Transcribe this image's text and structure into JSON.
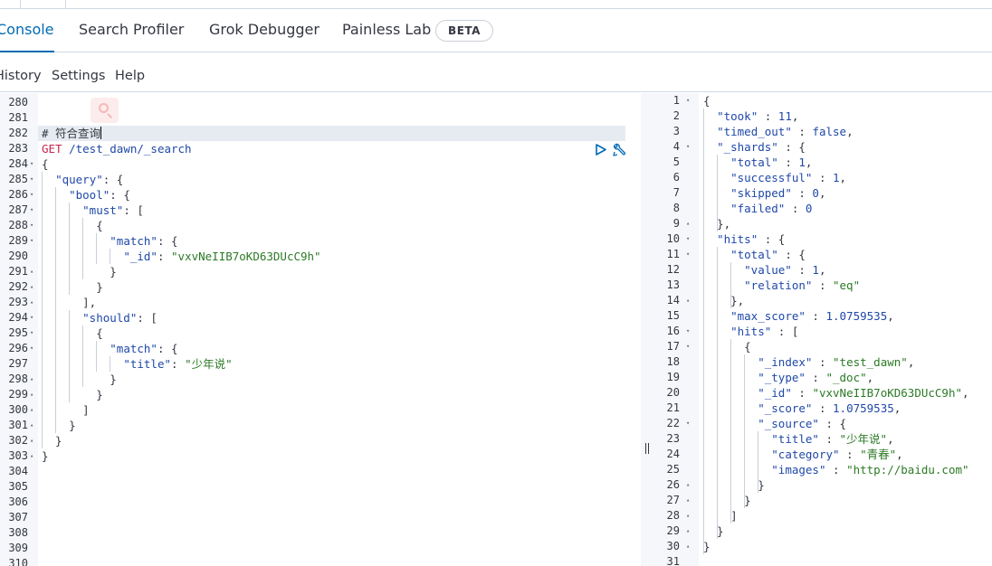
{
  "tabs": [
    {
      "label": "Console"
    },
    {
      "label": "Search Profiler"
    },
    {
      "label": "Grok Debugger"
    },
    {
      "label": "Painless Lab"
    }
  ],
  "beta_badge": "BETA",
  "subnav": {
    "history": "History",
    "settings": "Settings",
    "help": "Help"
  },
  "icons": {
    "run": "play-icon",
    "wrench": "wrench-icon",
    "search": "search-icon"
  },
  "colors": {
    "accent": "#006bb4",
    "string": "#2c7a25",
    "key": "#1f48a8",
    "method": "#c7254e"
  },
  "editor_lines": [
    {
      "n": "280",
      "fold": "",
      "code": ""
    },
    {
      "n": "281",
      "fold": "",
      "code": ""
    },
    {
      "n": "282",
      "fold": "",
      "code": "# 符合查询"
    },
    {
      "n": "283",
      "fold": "",
      "code": "GET /test_dawn/_search"
    },
    {
      "n": "284",
      "fold": "▾",
      "code": "{"
    },
    {
      "n": "285",
      "fold": "▾",
      "code": "  \"query\": {"
    },
    {
      "n": "286",
      "fold": "▾",
      "code": "    \"bool\": {"
    },
    {
      "n": "287",
      "fold": "▾",
      "code": "      \"must\": ["
    },
    {
      "n": "288",
      "fold": "▾",
      "code": "        {"
    },
    {
      "n": "289",
      "fold": "▾",
      "code": "          \"match\": {"
    },
    {
      "n": "290",
      "fold": "",
      "code": "            \"_id\": \"vxvNeIIB7oKD63DUcC9h\""
    },
    {
      "n": "291",
      "fold": "▴",
      "code": "          }"
    },
    {
      "n": "292",
      "fold": "▴",
      "code": "        }"
    },
    {
      "n": "293",
      "fold": "▴",
      "code": "      ],"
    },
    {
      "n": "294",
      "fold": "▾",
      "code": "      \"should\": ["
    },
    {
      "n": "295",
      "fold": "▾",
      "code": "        {"
    },
    {
      "n": "296",
      "fold": "▾",
      "code": "          \"match\": {"
    },
    {
      "n": "297",
      "fold": "",
      "code": "            \"title\": \"少年说\""
    },
    {
      "n": "298",
      "fold": "▴",
      "code": "          }"
    },
    {
      "n": "299",
      "fold": "▴",
      "code": "        }"
    },
    {
      "n": "300",
      "fold": "▴",
      "code": "      ]"
    },
    {
      "n": "301",
      "fold": "▴",
      "code": "    }"
    },
    {
      "n": "302",
      "fold": "▴",
      "code": "  }"
    },
    {
      "n": "303",
      "fold": "▴",
      "code": "}"
    },
    {
      "n": "304",
      "fold": "",
      "code": ""
    },
    {
      "n": "305",
      "fold": "",
      "code": ""
    },
    {
      "n": "306",
      "fold": "",
      "code": ""
    },
    {
      "n": "307",
      "fold": "",
      "code": ""
    },
    {
      "n": "308",
      "fold": "",
      "code": ""
    },
    {
      "n": "309",
      "fold": "",
      "code": ""
    },
    {
      "n": "310",
      "fold": "",
      "code": ""
    }
  ],
  "output_lines": [
    {
      "n": "1",
      "fold": "▾",
      "code": "{"
    },
    {
      "n": "2",
      "fold": "",
      "code": "  \"took\" : 11,"
    },
    {
      "n": "3",
      "fold": "",
      "code": "  \"timed_out\" : false,"
    },
    {
      "n": "4",
      "fold": "▾",
      "code": "  \"_shards\" : {"
    },
    {
      "n": "5",
      "fold": "",
      "code": "    \"total\" : 1,"
    },
    {
      "n": "6",
      "fold": "",
      "code": "    \"successful\" : 1,"
    },
    {
      "n": "7",
      "fold": "",
      "code": "    \"skipped\" : 0,"
    },
    {
      "n": "8",
      "fold": "",
      "code": "    \"failed\" : 0"
    },
    {
      "n": "9",
      "fold": "▴",
      "code": "  },"
    },
    {
      "n": "10",
      "fold": "▾",
      "code": "  \"hits\" : {"
    },
    {
      "n": "11",
      "fold": "▾",
      "code": "    \"total\" : {"
    },
    {
      "n": "12",
      "fold": "",
      "code": "      \"value\" : 1,"
    },
    {
      "n": "13",
      "fold": "",
      "code": "      \"relation\" : \"eq\""
    },
    {
      "n": "14",
      "fold": "▴",
      "code": "    },"
    },
    {
      "n": "15",
      "fold": "",
      "code": "    \"max_score\" : 1.0759535,"
    },
    {
      "n": "16",
      "fold": "▾",
      "code": "    \"hits\" : ["
    },
    {
      "n": "17",
      "fold": "▾",
      "code": "      {"
    },
    {
      "n": "18",
      "fold": "",
      "code": "        \"_index\" : \"test_dawn\","
    },
    {
      "n": "19",
      "fold": "",
      "code": "        \"_type\" : \"_doc\","
    },
    {
      "n": "20",
      "fold": "",
      "code": "        \"_id\" : \"vxvNeIIB7oKD63DUcC9h\","
    },
    {
      "n": "21",
      "fold": "",
      "code": "        \"_score\" : 1.0759535,"
    },
    {
      "n": "22",
      "fold": "▾",
      "code": "        \"_source\" : {"
    },
    {
      "n": "23",
      "fold": "",
      "code": "          \"title\" : \"少年说\","
    },
    {
      "n": "24",
      "fold": "",
      "code": "          \"category\" : \"青春\","
    },
    {
      "n": "25",
      "fold": "",
      "code": "          \"images\" : \"http://baidu.com\""
    },
    {
      "n": "26",
      "fold": "▴",
      "code": "        }"
    },
    {
      "n": "27",
      "fold": "▴",
      "code": "      }"
    },
    {
      "n": "28",
      "fold": "▴",
      "code": "    ]"
    },
    {
      "n": "29",
      "fold": "▴",
      "code": "  }"
    },
    {
      "n": "30",
      "fold": "▴",
      "code": "}"
    },
    {
      "n": "31",
      "fold": "",
      "code": ""
    }
  ]
}
